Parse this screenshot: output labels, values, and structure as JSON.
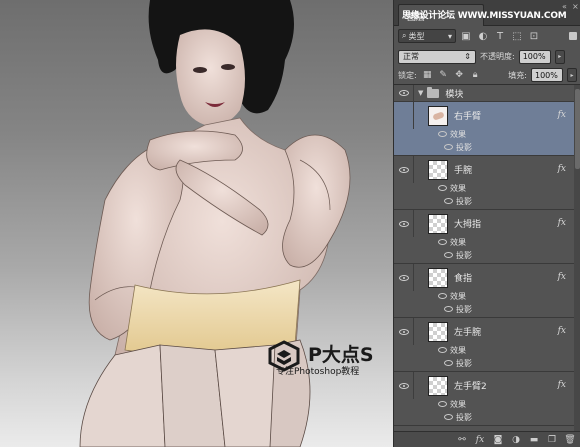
{
  "watermark": "思缘设计论坛 WWW.MISSYUAN.COM",
  "panel": {
    "tab_label": "图层",
    "filter": {
      "kind_label": "类型",
      "icons": [
        "pixel-filter-icon",
        "adjustment-filter-icon",
        "type-filter-icon",
        "shape-filter-icon",
        "smart-object-filter-icon"
      ]
    },
    "blend_mode": "正常",
    "opacity_label": "不透明度:",
    "opacity_value": "100%",
    "lock_label": "锁定:",
    "fill_label": "填充:",
    "fill_value": "100%"
  },
  "group": {
    "name": "模块"
  },
  "layers": [
    {
      "name": "右手臂",
      "selected": true,
      "fx": "fx",
      "effects_label": "效果",
      "effect": "投影"
    },
    {
      "name": "手腕",
      "selected": false,
      "fx": "fx",
      "effects_label": "效果",
      "effect": "投影"
    },
    {
      "name": "大拇指",
      "selected": false,
      "fx": "fx",
      "effects_label": "效果",
      "effect": "投影"
    },
    {
      "name": "食指",
      "selected": false,
      "fx": "fx",
      "effects_label": "效果",
      "effect": "投影"
    },
    {
      "name": "左手腕",
      "selected": false,
      "fx": "fx",
      "effects_label": "效果",
      "effect": "投影"
    },
    {
      "name": "左手臂2",
      "selected": false,
      "fx": "fx",
      "effects_label": "效果",
      "effect": "投影"
    }
  ],
  "footer_icons": [
    "link-layers-icon",
    "fx-icon",
    "mask-icon",
    "adjustment-icon",
    "new-group-icon",
    "new-layer-icon",
    "trash-icon"
  ],
  "brand": {
    "title": "P大点S",
    "subtitle": "专注Photoshop教程"
  },
  "colors": {
    "panel_bg": "#535353",
    "selected_layer": "#6f7e97",
    "canvas_bg_top": "#6e6e6e"
  }
}
